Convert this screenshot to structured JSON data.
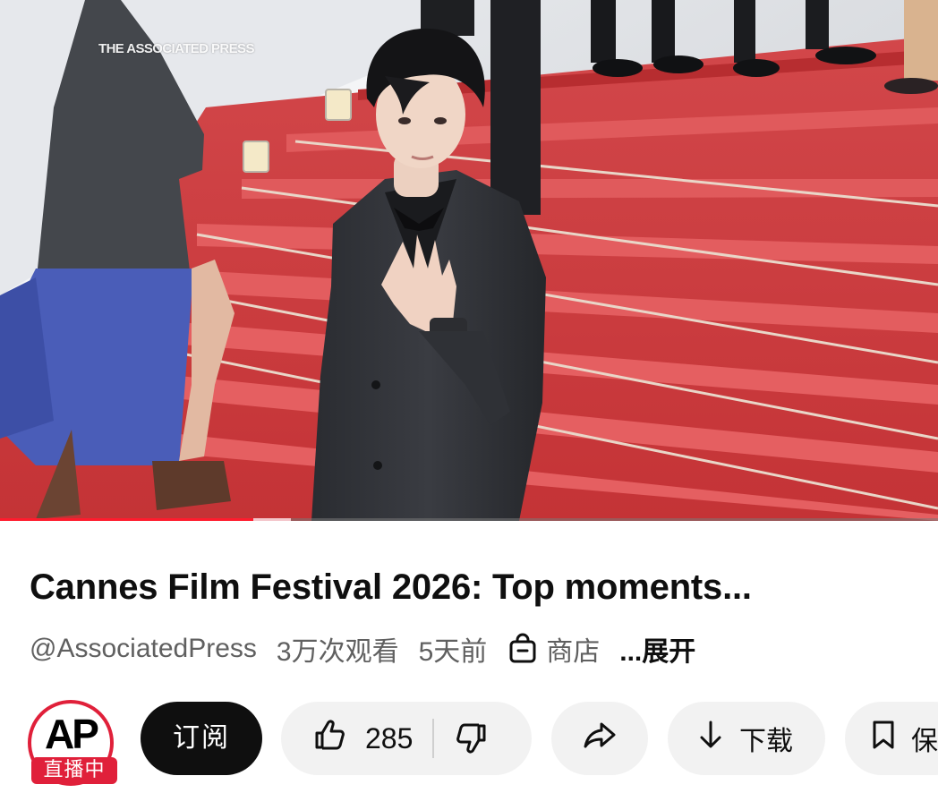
{
  "video": {
    "watermark": "THE ASSOCIATED PRESS",
    "progress_played_fraction": 0.27,
    "progress_buffered_fraction": 0.31
  },
  "title": "Cannes Film Festival 2026: Top moments...",
  "meta": {
    "channel": "@AssociatedPress",
    "views": "3万次观看",
    "age": "5天前",
    "store_label": "商店",
    "more_label": "...展开"
  },
  "channel": {
    "avatar_text": "AP",
    "live_badge": "直播中"
  },
  "actions": {
    "subscribe_label": "订阅",
    "like_count": "285",
    "download_label": "下载",
    "save_label": "保"
  },
  "icons": {
    "store": "shopping-bag-icon",
    "like": "thumb-up-icon",
    "dislike": "thumb-down-icon",
    "share": "share-arrow-icon",
    "download": "download-arrow-icon",
    "save": "bookmark-icon"
  },
  "colors": {
    "accent_red": "#ff1b2d",
    "live_red": "#e0203a",
    "carpet_red": "#c93a3c",
    "text_primary": "#0f0f0f",
    "text_secondary": "#606060",
    "pill_background": "#f2f2f2"
  }
}
